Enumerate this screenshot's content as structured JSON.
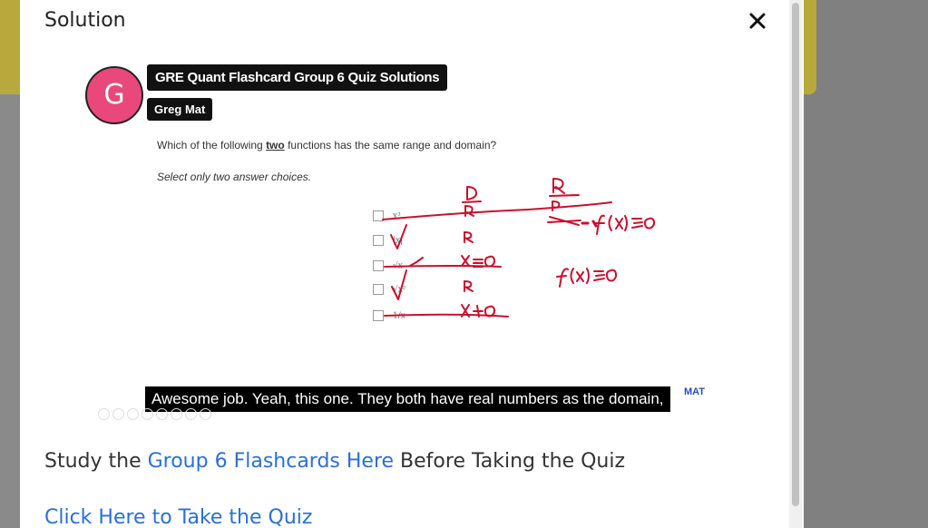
{
  "modal": {
    "title": "Solution",
    "close_icon": "close-icon"
  },
  "video": {
    "avatar_letter": "G",
    "title": "GRE Quant Flashcard Group 6 Quiz Solutions",
    "author": "Greg Mat",
    "question_pre": "Which of the following ",
    "question_emph": "two",
    "question_post": " functions has the same range and domain?",
    "instruction": "Select only two answer choices.",
    "options": [
      "x³",
      "|x|",
      "√x",
      "√x²",
      "1/x"
    ],
    "subtitle": "Awesome job. Yeah, this one. They both have real numbers as the domain,",
    "watermark": "MAT",
    "ink_color": "#c8102e"
  },
  "study": {
    "pre": "Study the ",
    "link": "Group 6 Flashcards Here",
    "post": " Before Taking the Quiz"
  },
  "quiz_link": "Click Here to Take the Quiz"
}
